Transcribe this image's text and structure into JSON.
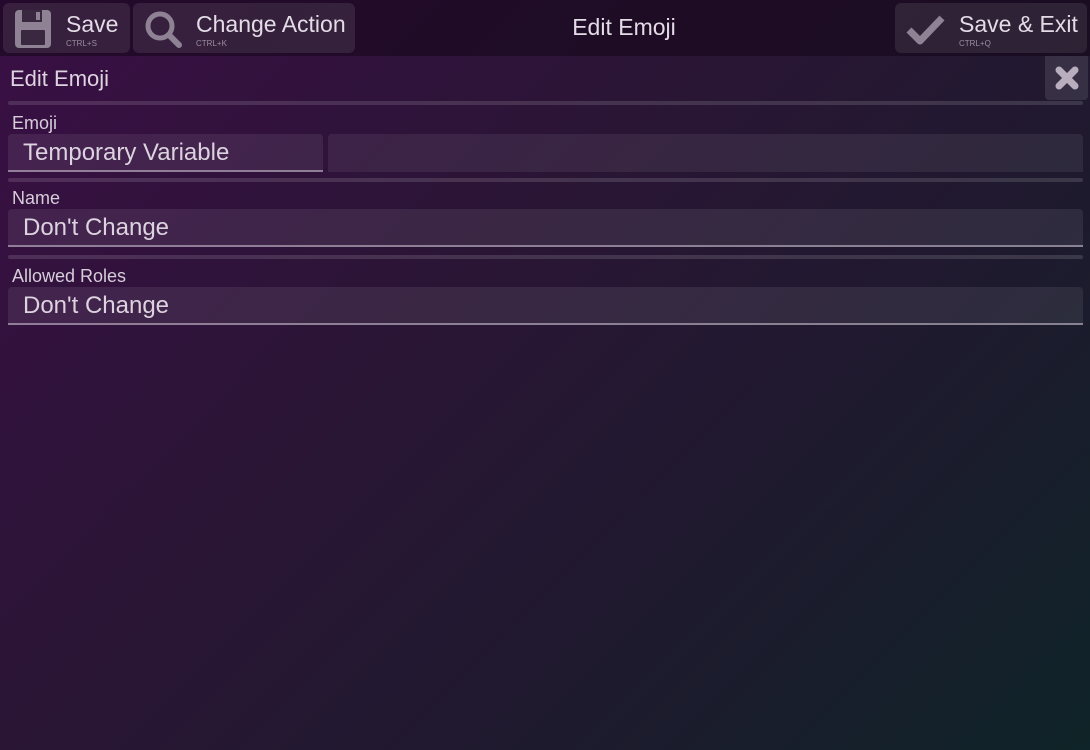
{
  "toolbar": {
    "save": {
      "label": "Save",
      "shortcut": "CTRL+S",
      "icon": "floppy-disk-icon"
    },
    "change_action": {
      "label": "Change Action",
      "shortcut": "CTRL+K",
      "icon": "search-icon"
    },
    "save_exit": {
      "label": "Save & Exit",
      "shortcut": "CTRL+Q",
      "icon": "checkmark-icon"
    }
  },
  "window_title": "Edit Emoji",
  "panel": {
    "title": "Edit Emoji",
    "close_icon": "close-icon"
  },
  "fields": {
    "emoji": {
      "label": "Emoji",
      "source": "Temporary Variable",
      "value": ""
    },
    "name": {
      "label": "Name",
      "value": "Don't Change"
    },
    "allowed_roles": {
      "label": "Allowed Roles",
      "value": "Don't Change"
    }
  },
  "colors": {
    "icon": "#8e8294",
    "background_start": "#3a0f45",
    "background_end": "#0f2428"
  }
}
